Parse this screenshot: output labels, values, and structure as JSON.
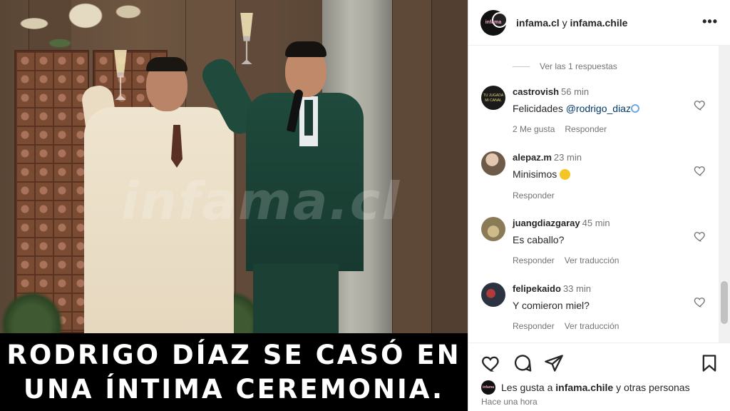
{
  "post": {
    "account_title_bold1": "infama.cl",
    "account_title_connector": " y ",
    "account_title_bold2": "infama.chile",
    "avatar_text": "infama",
    "more_icon": "more-horizontal-icon",
    "image_watermark": "infama.cl"
  },
  "caption": {
    "line1": "RODRIGO DÍAZ SE CASÓ EN",
    "line2": "UNA ÍNTIMA CEREMONIA."
  },
  "comments": {
    "view_replies": "Ver las 1 respuestas",
    "items": [
      {
        "username": "castrovish",
        "time": "56 min",
        "text_prefix": "Felicidades ",
        "mention": "@rodrigo_diaz",
        "emoji": "ring-emoji",
        "likes": "2 Me gusta",
        "reply": "Responder",
        "translate": "",
        "avatar_color": "#1a1a1a"
      },
      {
        "username": "alepaz.m",
        "time": "23 min",
        "text": "Minisimos",
        "emoji": "downcast-face-emoji",
        "reply": "Responder",
        "translate": "",
        "avatar_color": "#6d5a48"
      },
      {
        "username": "juangdiazgaray",
        "time": "45 min",
        "text": "Es caballo?",
        "reply": "Responder",
        "translate": "Ver traducción",
        "avatar_color": "#8a7a56"
      },
      {
        "username": "felipekaido",
        "time": "33 min",
        "text": "Y comieron miel?",
        "reply": "Responder",
        "translate": "Ver traducción",
        "avatar_color": "#2b3240"
      }
    ]
  },
  "actions": {
    "icons": [
      "heart-icon",
      "comment-icon",
      "share-icon",
      "save-icon"
    ],
    "likes_prefix": "Les gusta a ",
    "likes_user": "infama.chile",
    "likes_suffix": " y otras personas",
    "posted": "Hace una hora"
  }
}
